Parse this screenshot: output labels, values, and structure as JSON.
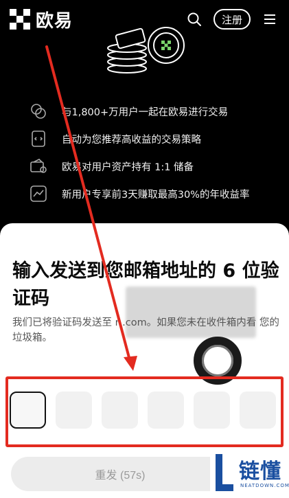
{
  "header": {
    "brand": "欧易",
    "register_label": "注册"
  },
  "features": [
    {
      "icon": "coins-icon",
      "text": "与1,800+万用户一起在欧易进行交易"
    },
    {
      "icon": "strategy-icon",
      "text": "自动为您推荐高收益的交易策略"
    },
    {
      "icon": "wallet-icon",
      "text": "欧易对用户资产持有 1:1 储备"
    },
    {
      "icon": "chart-icon",
      "text": "新用户专享前3天赚取最高30%的年收益率"
    }
  ],
  "sheet": {
    "title": "输入发送到您邮箱地址的 6 位验证码",
    "description": "我们已将验证码发送至 r                    .com。如果您未在收件箱内看                     您的垃圾箱。",
    "code_length": 6,
    "resend_label": "重发 (57s)"
  },
  "watermark": {
    "text": "链懂",
    "sub": "NEATDOWN.COM"
  },
  "colors": {
    "accent_red": "#e32b20",
    "watermark_blue": "#1a4fa0"
  }
}
